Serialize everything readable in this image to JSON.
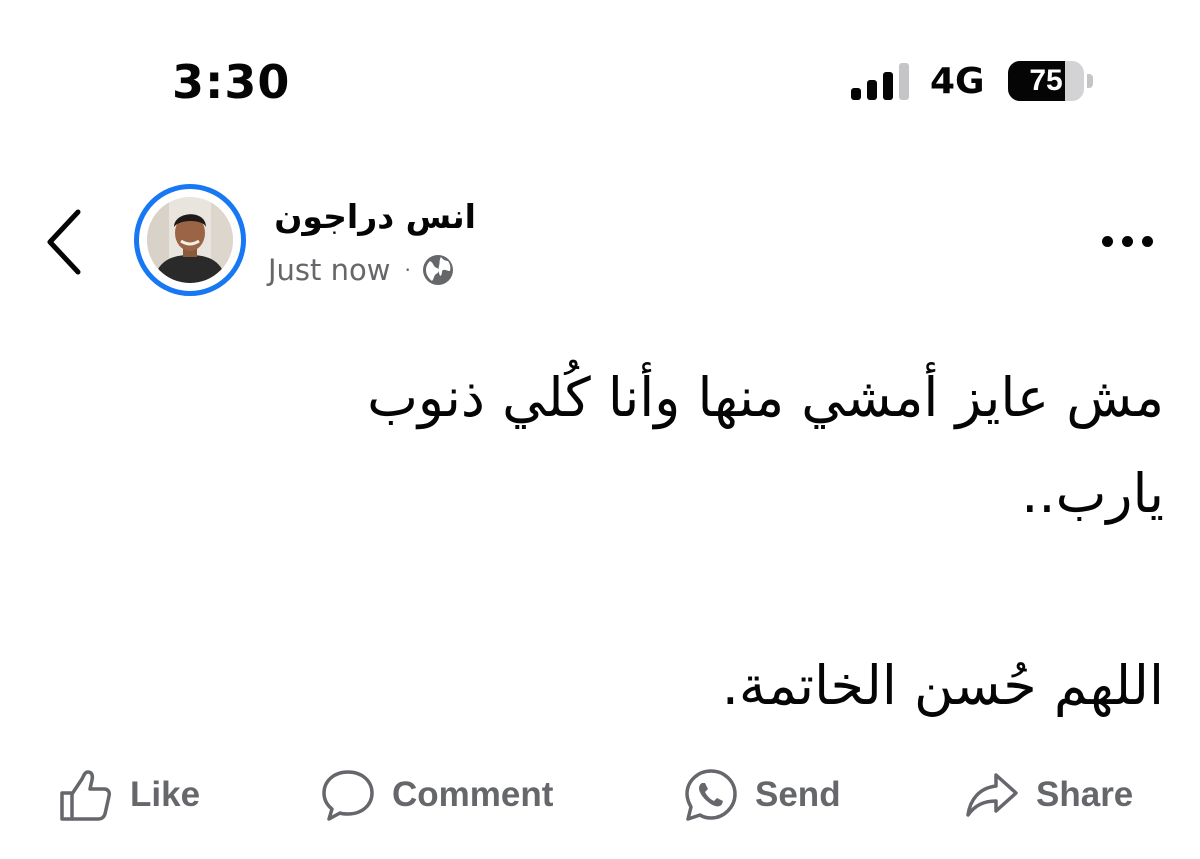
{
  "status_bar": {
    "time": "3:30",
    "network": "4G",
    "battery_level": "75",
    "battery_fraction": 0.75,
    "signal_bars_active": 3,
    "signal_bars_total": 4
  },
  "post": {
    "author_name": "انس دراجون",
    "timestamp": "Just now",
    "separator": "·",
    "audience_icon": "globe-icon",
    "body_lines": [
      "مش عايز أمشي منها وأنا كُلي ذنوب",
      "يارب..",
      "",
      "اللهم حُسن الخاتمة."
    ]
  },
  "actions": {
    "like_label": "Like",
    "comment_label": "Comment",
    "send_label": "Send",
    "share_label": "Share"
  },
  "colors": {
    "accent": "#1877f2",
    "text_primary": "#050505",
    "text_secondary": "#65676b"
  }
}
